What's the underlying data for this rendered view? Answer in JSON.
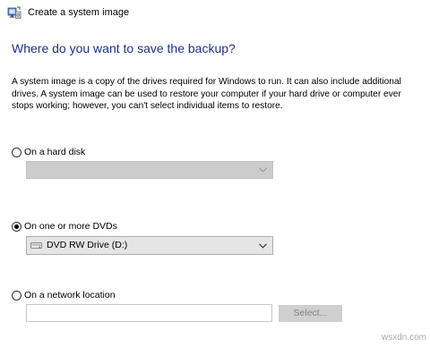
{
  "window": {
    "title": "Create a system image",
    "icon": "system-image-icon"
  },
  "heading": "Where do you want to save the backup?",
  "description": "A system image is a copy of the drives required for Windows to run. It can also include additional drives. A system image can be used to restore your computer if your hard drive or computer ever stops working; however, you can't select individual items to restore.",
  "options": {
    "hard_disk": {
      "label": "On a hard disk",
      "checked": false,
      "dropdown_value": "",
      "dropdown_enabled": false
    },
    "dvds": {
      "label": "On one or more DVDs",
      "checked": true,
      "dropdown_value": "DVD RW Drive (D:)",
      "dropdown_icon": "dvd-drive-icon",
      "dropdown_enabled": true
    },
    "network": {
      "label": "On a network location",
      "checked": false,
      "input_value": "",
      "select_button_label": "Select...",
      "select_button_enabled": false
    }
  },
  "colors": {
    "heading": "#1e3287",
    "disabled_field": "#cccccc",
    "enabled_field": "#e5e5e5"
  },
  "watermark": "wsxdn.com"
}
